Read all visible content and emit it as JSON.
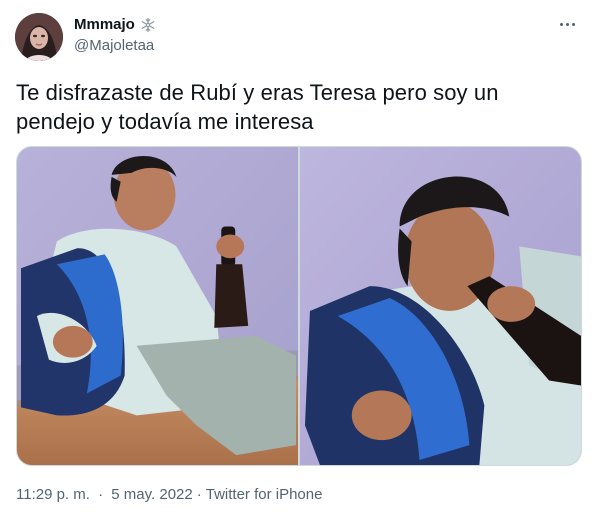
{
  "author": {
    "display_name": "Mmmajo",
    "handle": "@Majoletaa",
    "badge_icon": "snowflake-icon",
    "avatar_icon": "avatar-photo"
  },
  "menu": {
    "more_icon": "more-horizontal-icon"
  },
  "tweet": {
    "text_line1": "Te disfrazaste de Rubí y eras Teresa pero soy un",
    "text_line2": "pendejo y todavía me interesa"
  },
  "media": [
    {
      "icon": "photo-man-with-speaker-and-bottle"
    },
    {
      "icon": "photo-man-drinking-from-bottle"
    }
  ],
  "meta": {
    "time": "11:29 p. m.",
    "date": "5 may. 2022",
    "separator": "·",
    "source": "Twitter for iPhone"
  },
  "colors": {
    "text_primary": "#0f1419",
    "text_secondary": "#536471",
    "border": "#cfd9de",
    "background": "#ffffff"
  }
}
